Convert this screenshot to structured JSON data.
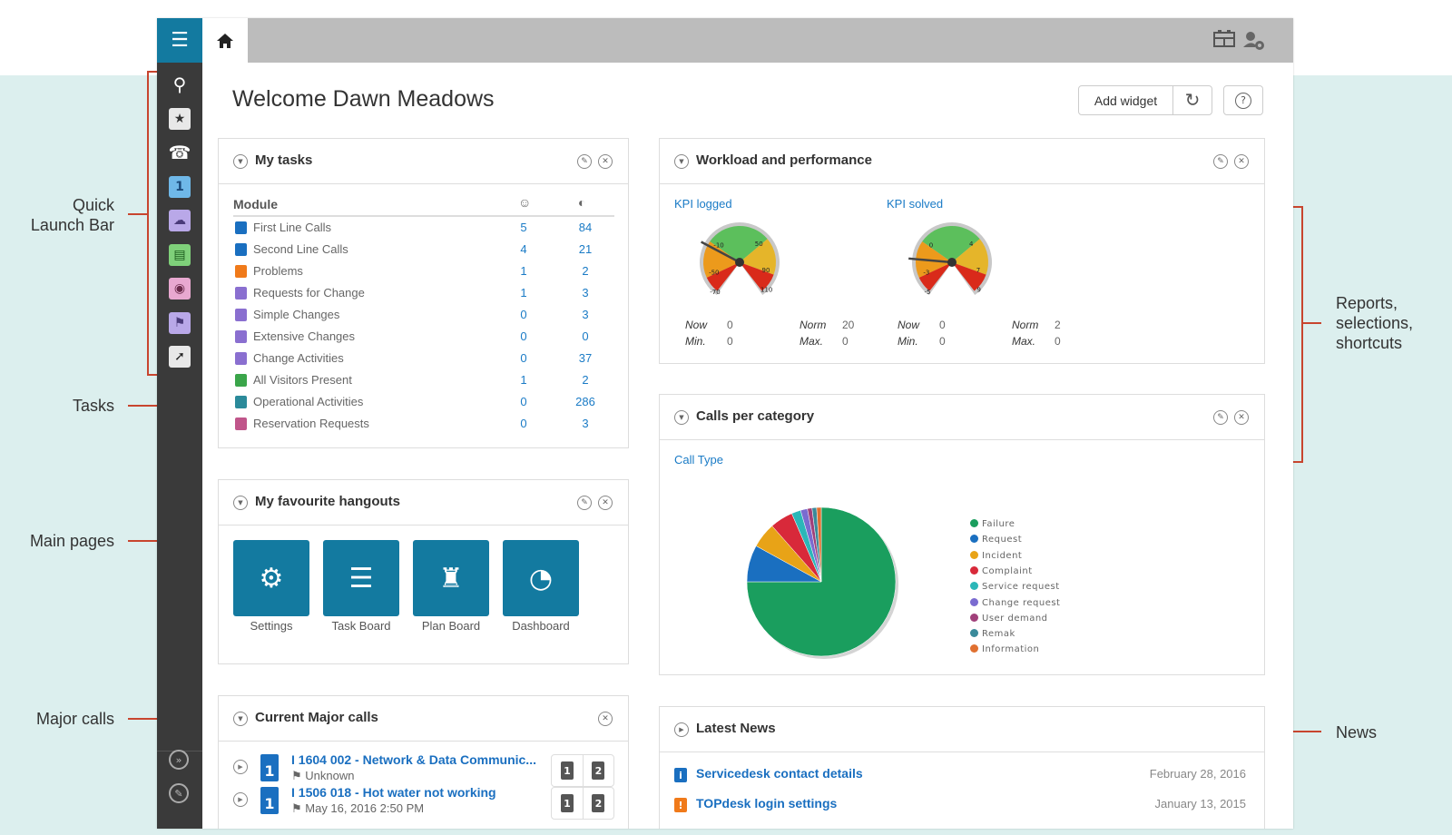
{
  "callouts": {
    "quick_launch": [
      "Quick",
      "Launch Bar"
    ],
    "tasks": "Tasks",
    "main_pages": "Main pages",
    "major_calls": "Major calls",
    "reports": [
      "Reports,",
      "selections,",
      "shortcuts"
    ],
    "news": "News"
  },
  "colors": {
    "brand": "#137aa0",
    "sidebar": "#3a3a3a",
    "link": "#1a7bc6",
    "callout_line": "#c8452e",
    "band": "#dcefee"
  },
  "sidebar": {
    "menu_icon": "hamburger-icon",
    "items": [
      {
        "name": "search",
        "icon": "search-icon",
        "glyph": "⚲"
      },
      {
        "name": "favourites",
        "icon": "clipboard-star-icon",
        "glyph": "★"
      },
      {
        "name": "caller",
        "icon": "phone-person-icon",
        "glyph": "☎"
      },
      {
        "name": "first-line-calls",
        "icon": "first-line-call-icon",
        "glyph": "1"
      },
      {
        "name": "requests-for-change",
        "icon": "cloud-speech-icon",
        "glyph": "☁"
      },
      {
        "name": "visitors",
        "icon": "id-badge-icon",
        "glyph": "▤"
      },
      {
        "name": "reservations",
        "icon": "calendar-target-icon",
        "glyph": "◉"
      },
      {
        "name": "plan-board",
        "icon": "calendar-flag-icon",
        "glyph": "⚑"
      },
      {
        "name": "shortcut",
        "icon": "arrow-shortcut-icon",
        "glyph": "➚"
      }
    ],
    "bottom": [
      {
        "name": "expand",
        "icon": "double-chevron-icon",
        "glyph": "»"
      },
      {
        "name": "edit",
        "icon": "pencil-icon",
        "glyph": "✎"
      }
    ]
  },
  "topbar": {
    "home_icon": "home-icon",
    "right_icons": [
      "layout-icon",
      "user-settings-icon"
    ]
  },
  "header": {
    "welcome": "Welcome Dawn Meadows",
    "add_widget": "Add widget",
    "refresh_icon": "refresh-icon",
    "help_icon": "help-icon"
  },
  "my_tasks": {
    "title": "My tasks",
    "columns": {
      "module": "Module",
      "col1_icon": "personal-icon",
      "col2_icon": "operator-group-icon"
    },
    "rows": [
      {
        "label": "First Line Calls",
        "personal": "5",
        "group": "84",
        "color": "#1a6fc0",
        "icon": "first-line-icon"
      },
      {
        "label": "Second Line Calls",
        "personal": "4",
        "group": "21",
        "color": "#1a6fc0",
        "icon": "second-line-icon"
      },
      {
        "label": "Problems",
        "personal": "1",
        "group": "2",
        "color": "#f07a1a",
        "icon": "cone-icon"
      },
      {
        "label": "Requests for Change",
        "personal": "1",
        "group": "3",
        "color": "#8a6fd0",
        "icon": "rfc-icon"
      },
      {
        "label": "Simple Changes",
        "personal": "0",
        "group": "3",
        "color": "#8a6fd0",
        "icon": "simple-change-icon"
      },
      {
        "label": "Extensive Changes",
        "personal": "0",
        "group": "0",
        "color": "#8a6fd0",
        "icon": "extensive-change-icon"
      },
      {
        "label": "Change Activities",
        "personal": "0",
        "group": "37",
        "color": "#8a6fd0",
        "icon": "hammer-icon"
      },
      {
        "label": "All Visitors Present",
        "personal": "1",
        "group": "2",
        "color": "#3aa54a",
        "icon": "visitor-badge-icon"
      },
      {
        "label": "Operational Activities",
        "personal": "0",
        "group": "286",
        "color": "#2b8a9a",
        "icon": "wrench-icon"
      },
      {
        "label": "Reservation Requests",
        "personal": "0",
        "group": "3",
        "color": "#c0558a",
        "icon": "reservation-icon"
      }
    ]
  },
  "hangouts": {
    "title": "My favourite hangouts",
    "tiles": [
      {
        "label": "Settings",
        "icon": "gears-icon",
        "glyph": "⚙"
      },
      {
        "label": "Task Board",
        "icon": "clipboard-list-icon",
        "glyph": "☰"
      },
      {
        "label": "Plan Board",
        "icon": "control-tower-icon",
        "glyph": "♜"
      },
      {
        "label": "Dashboard",
        "icon": "dashboard-gauge-icon",
        "glyph": "◔"
      }
    ]
  },
  "major_calls": {
    "title": "Current Major calls",
    "rows": [
      {
        "title": "I 1604 002 - Network & Data Communic...",
        "sub": "Unknown",
        "badge": "1"
      },
      {
        "title": "I 1506 018 - Hot water not working",
        "sub": "May 16, 2016 2:50 PM",
        "badge": "1"
      }
    ],
    "chip_labels": [
      "1",
      "2"
    ]
  },
  "workload": {
    "title": "Workload and performance",
    "gauges": [
      {
        "label": "KPI logged",
        "ticks": [
          "-70",
          "-50",
          "-10",
          "50",
          "90",
          "110"
        ],
        "now": "0",
        "min": "0",
        "norm": "20",
        "max": "0",
        "needle_value": -35
      },
      {
        "label": "KPI solved",
        "ticks": [
          "-5",
          "-3",
          "0",
          "4",
          "7",
          "9"
        ],
        "now": "0",
        "min": "0",
        "norm": "2",
        "max": "0",
        "needle_value": -3.6
      }
    ],
    "stat_labels": {
      "now": "Now",
      "min": "Min.",
      "norm": "Norm",
      "max": "Max."
    }
  },
  "calls_per_category": {
    "title": "Calls per category",
    "subtitle": "Call Type"
  },
  "chart_data": {
    "type": "pie",
    "title": "Call Type",
    "legend_position": "right",
    "categories": [
      "Failure",
      "Request",
      "Incident",
      "Complaint",
      "Service request",
      "Change request",
      "User demand",
      "Remak",
      "Information"
    ],
    "values": [
      75,
      8,
      5.5,
      5,
      2,
      1.5,
      1,
      1,
      1
    ],
    "colors": [
      "#1a9e5e",
      "#1a6fc0",
      "#e8a317",
      "#d8293a",
      "#2bb7b8",
      "#7a6bd0",
      "#a0407a",
      "#3a8a9a",
      "#e07030"
    ]
  },
  "news": {
    "title": "Latest News",
    "items": [
      {
        "title": "Servicedesk contact details",
        "date": "February 28, 2016",
        "color": "#1a6fc0",
        "glyph": "i",
        "icon": "info-icon"
      },
      {
        "title": "TOPdesk login settings",
        "date": "January 13, 2015",
        "color": "#f07a1a",
        "glyph": "!",
        "icon": "notice-icon"
      }
    ]
  }
}
